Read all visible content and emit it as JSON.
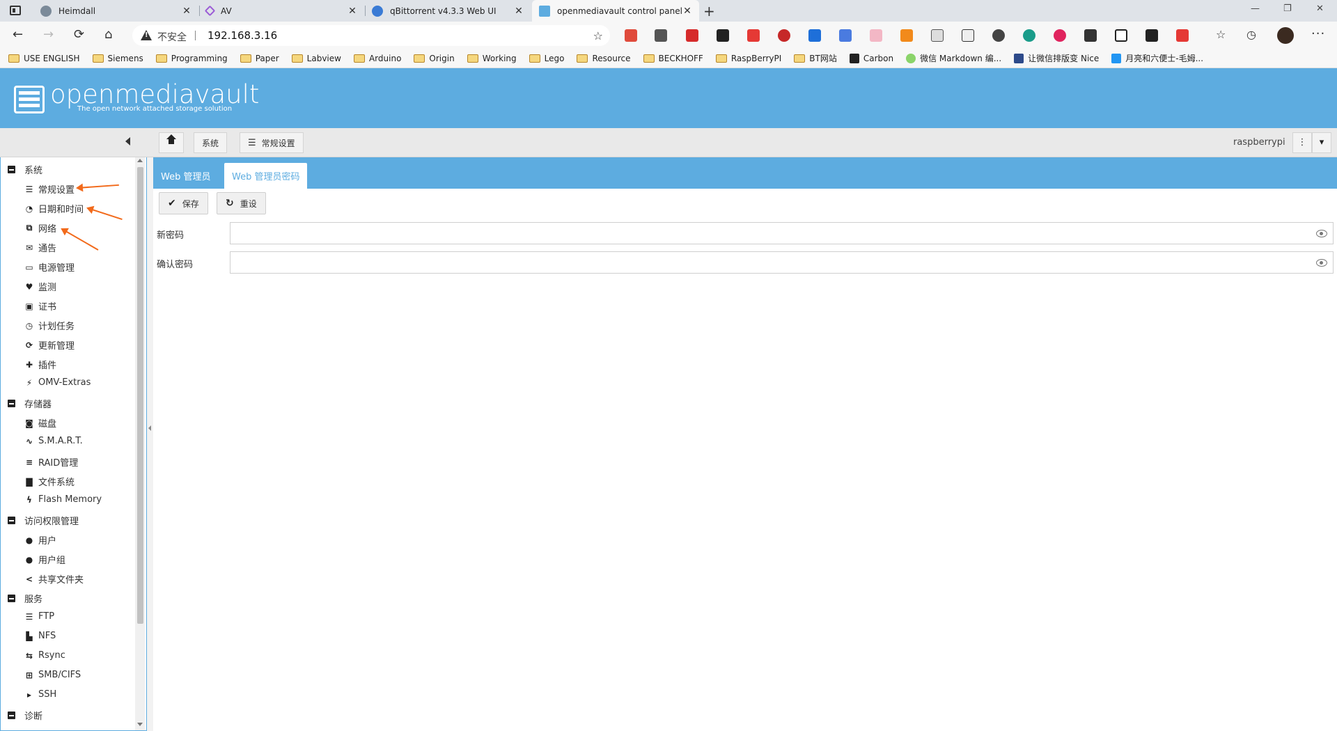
{
  "browser": {
    "tabs": [
      {
        "title": "Heimdall",
        "icon": "heimdall-icon",
        "color": "#7b8a99"
      },
      {
        "title": "AV",
        "icon": "av-icon",
        "color": "#9b5bd6"
      },
      {
        "title": "qBittorrent v4.3.3 Web UI",
        "icon": "qbittorrent-icon",
        "color": "#3a7bd5"
      },
      {
        "title": "openmediavault control panel - (",
        "icon": "omv-tab-icon",
        "color": "#5dace0"
      }
    ],
    "window_controls": {
      "minimize": "—",
      "restore": "❐",
      "close": "✕"
    },
    "address": {
      "security_label": "不安全",
      "url": "192.168.3.16"
    },
    "bookmarks": [
      {
        "label": "USE ENGLISH",
        "type": "folder"
      },
      {
        "label": "Siemens",
        "type": "folder"
      },
      {
        "label": "Programming",
        "type": "folder"
      },
      {
        "label": "Paper",
        "type": "folder"
      },
      {
        "label": "Labview",
        "type": "folder"
      },
      {
        "label": "Arduino",
        "type": "folder"
      },
      {
        "label": "Origin",
        "type": "folder"
      },
      {
        "label": "Working",
        "type": "folder"
      },
      {
        "label": "Lego",
        "type": "folder"
      },
      {
        "label": "Resource",
        "type": "folder"
      },
      {
        "label": "BECKHOFF",
        "type": "folder"
      },
      {
        "label": "RaspBerryPI",
        "type": "folder"
      },
      {
        "label": "BT网站",
        "type": "folder"
      },
      {
        "label": "Carbon",
        "type": "site",
        "color": "#222222"
      },
      {
        "label": "微信 Markdown 编...",
        "type": "site",
        "color": "#8bd46a"
      },
      {
        "label": "让微信排版变 Nice",
        "type": "site",
        "color": "#2d4a8a"
      },
      {
        "label": "月亮和六便士-毛姆...",
        "type": "site",
        "color": "#2196f3"
      }
    ]
  },
  "omv": {
    "logo_title": "openmediavault",
    "logo_subtitle": "The open network attached storage solution",
    "breadcrumb": [
      "系统",
      "常规设置"
    ],
    "hostname": "raspberrypi",
    "sidebar": {
      "groups": [
        {
          "label": "系统",
          "items": [
            {
              "label": "常规设置",
              "icon": "sliders-icon",
              "glyph": "☰"
            },
            {
              "label": "日期和时间",
              "icon": "clock-icon",
              "glyph": "◔"
            },
            {
              "label": "网络",
              "icon": "network-icon",
              "glyph": "⧉"
            },
            {
              "label": "通告",
              "icon": "envelope-icon",
              "glyph": "✉"
            },
            {
              "label": "电源管理",
              "icon": "battery-icon",
              "glyph": "▭"
            },
            {
              "label": "监测",
              "icon": "heartbeat-icon",
              "glyph": "♥"
            },
            {
              "label": "证书",
              "icon": "certificate-icon",
              "glyph": "▣"
            },
            {
              "label": "计划任务",
              "icon": "calendar-clock-icon",
              "glyph": "◷"
            },
            {
              "label": "更新管理",
              "icon": "sync-icon",
              "glyph": "⟳"
            },
            {
              "label": "插件",
              "icon": "puzzle-icon",
              "glyph": "✚"
            },
            {
              "label": "OMV-Extras",
              "icon": "plug-icon",
              "glyph": "⚡"
            }
          ]
        },
        {
          "label": "存储器",
          "items": [
            {
              "label": "磁盘",
              "icon": "harddisk-icon",
              "glyph": "◙"
            },
            {
              "label": "S.M.A.R.T.",
              "icon": "pulse-icon",
              "glyph": "∿"
            },
            {
              "label": "RAID管理",
              "icon": "database-icon",
              "glyph": "≡"
            },
            {
              "label": "文件系统",
              "icon": "folders-icon",
              "glyph": "▇"
            },
            {
              "label": "Flash Memory",
              "icon": "flash-icon",
              "glyph": "ϟ"
            }
          ]
        },
        {
          "label": "访问权限管理",
          "items": [
            {
              "label": "用户",
              "icon": "user-icon",
              "glyph": "●"
            },
            {
              "label": "用户组",
              "icon": "users-icon",
              "glyph": "●●"
            },
            {
              "label": "共享文件夹",
              "icon": "share-icon",
              "glyph": "<"
            }
          ]
        },
        {
          "label": "服务",
          "items": [
            {
              "label": "FTP",
              "icon": "ftp-server-icon",
              "glyph": "☰"
            },
            {
              "label": "NFS",
              "icon": "nfs-server-icon",
              "glyph": "▙"
            },
            {
              "label": "Rsync",
              "icon": "rsync-icon",
              "glyph": "⇆"
            },
            {
              "label": "SMB/CIFS",
              "icon": "windows-icon",
              "glyph": "⊞"
            },
            {
              "label": "SSH",
              "icon": "terminal-icon",
              "glyph": "▸"
            }
          ]
        },
        {
          "label": "诊断",
          "items": []
        }
      ]
    },
    "content_tabs": [
      {
        "label": "Web 管理员",
        "active": false
      },
      {
        "label": "Web 管理员密码",
        "active": true
      }
    ],
    "actions": {
      "save_label": "保存",
      "reset_label": "重设"
    },
    "form": {
      "new_password_label": "新密码",
      "new_password_value": "",
      "confirm_password_label": "确认密码",
      "confirm_password_value": ""
    },
    "colors": {
      "header": "#5dace0",
      "annotation_arrow": "#f26a1b"
    }
  }
}
